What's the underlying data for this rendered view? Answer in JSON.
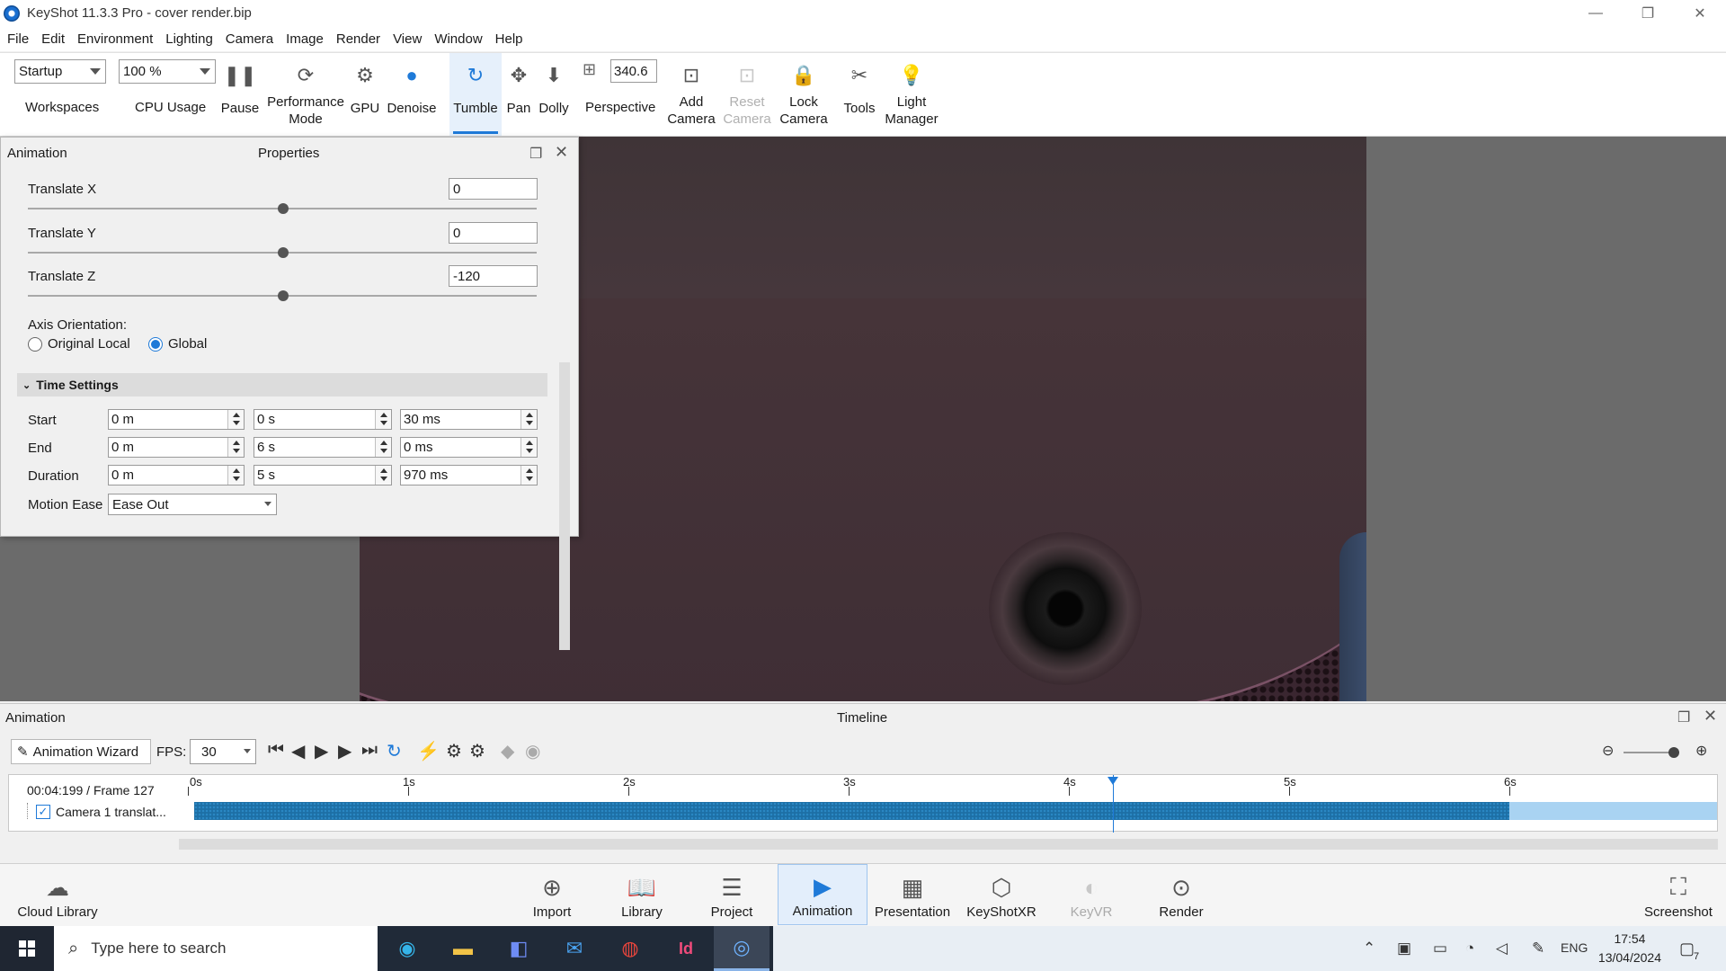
{
  "window": {
    "title": "KeyShot 11.3.3 Pro  - cover render.bip",
    "minimize": "—",
    "restore": "❐",
    "close": "✕"
  },
  "menu": [
    "File",
    "Edit",
    "Environment",
    "Lighting",
    "Camera",
    "Image",
    "Render",
    "View",
    "Window",
    "Help"
  ],
  "ribbon": {
    "workspace_value": "Startup",
    "cpu_value": "100 %",
    "fov_value": "340.6",
    "workspaces": "Workspaces",
    "cpu_usage": "CPU Usage",
    "pause": "Pause",
    "performance_mode": "Performance Mode",
    "gpu": "GPU",
    "denoise": "Denoise",
    "tumble": "Tumble",
    "pan": "Pan",
    "dolly": "Dolly",
    "perspective": "Perspective",
    "add_camera": "Add Camera",
    "reset_camera": "Reset Camera",
    "lock_camera": "Lock Camera",
    "tools": "Tools",
    "light_manager": "Light Manager"
  },
  "properties_panel": {
    "left_title": "Animation",
    "title": "Properties",
    "translate_x_label": "Translate X",
    "translate_x": "0",
    "translate_y_label": "Translate Y",
    "translate_y": "0",
    "translate_z_label": "Translate Z",
    "translate_z": "-120",
    "axis_orientation_label": "Axis Orientation:",
    "axis_original_local": "Original Local",
    "axis_global": "Global",
    "axis_selected": "Global",
    "time_settings_label": "Time Settings",
    "start_label": "Start",
    "start_m": "0 m",
    "start_s": "0 s",
    "start_ms": "30 ms",
    "end_label": "End",
    "end_m": "0 m",
    "end_s": "6 s",
    "end_ms": "0 ms",
    "duration_label": "Duration",
    "duration_m": "0 m",
    "duration_s": "5 s",
    "duration_ms": "970 ms",
    "motion_ease_label": "Motion Ease",
    "motion_ease_value": "Ease Out"
  },
  "timeline": {
    "left_title": "Animation",
    "title": "Timeline",
    "animation_wizard": "Animation Wizard",
    "fps_label": "FPS:",
    "fps_value": "30",
    "current_time": "00:04:199 / Frame 127",
    "track_name": "Camera 1 translat...",
    "ticks": [
      "0s",
      "1s",
      "2s",
      "3s",
      "4s",
      "5s",
      "6s"
    ],
    "playhead_seconds": 4.2,
    "clip_start_s": 0.03,
    "clip_end_s": 6.0
  },
  "bottombar": {
    "cloud_library": "Cloud Library",
    "import": "Import",
    "library": "Library",
    "project": "Project",
    "animation": "Animation",
    "presentation": "Presentation",
    "keyshotxr": "KeyShotXR",
    "keyvr": "KeyVR",
    "render": "Render",
    "screenshot": "Screenshot"
  },
  "taskbar": {
    "search_placeholder": "Type here to search",
    "language": "ENG",
    "time": "17:54",
    "date": "13/04/2024",
    "notifications": "7"
  },
  "colors": {
    "accent": "#1f7ad8",
    "track_bar": "#1d6fa5",
    "taskbar_dark": "#202a38"
  }
}
